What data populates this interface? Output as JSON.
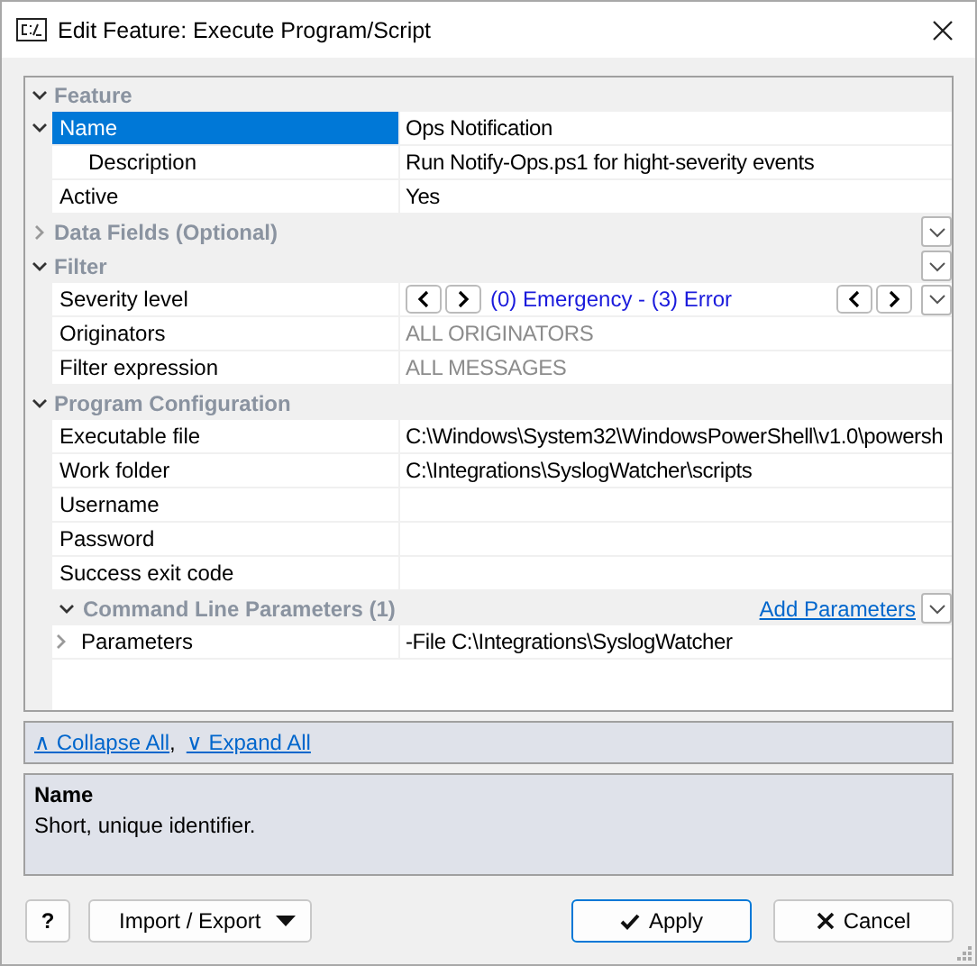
{
  "window": {
    "title": "Edit Feature: Execute Program/Script"
  },
  "grid": {
    "sections": [
      {
        "label": "Feature",
        "expanded": true,
        "menu_button": false,
        "rows": [
          {
            "kind": "text",
            "label": "Name",
            "value": "Ops Notification",
            "selected": true,
            "muted": false,
            "expanded": true,
            "children": [
              {
                "kind": "text",
                "label": "Description",
                "value": "Run Notify-Ops.ps1 for hight-severity events",
                "selected": false,
                "muted": false
              }
            ]
          },
          {
            "kind": "text",
            "label": "Active",
            "value": "Yes",
            "selected": false,
            "muted": false
          }
        ]
      },
      {
        "label": "Data Fields (Optional)",
        "expanded": false,
        "menu_button": true
      },
      {
        "label": "Filter",
        "expanded": true,
        "menu_button": true,
        "rows": [
          {
            "kind": "range",
            "label": "Severity level",
            "value": "(0) Emergency - (3) Error",
            "selected": false,
            "muted": false
          },
          {
            "kind": "text",
            "label": "Originators",
            "value": "ALL ORIGINATORS",
            "selected": false,
            "muted": true
          },
          {
            "kind": "text",
            "label": "Filter expression",
            "value": "ALL MESSAGES",
            "selected": false,
            "muted": true
          }
        ]
      },
      {
        "label": "Program Configuration",
        "expanded": true,
        "menu_button": false,
        "rows": [
          {
            "kind": "text",
            "label": "Executable file",
            "value": "C:\\Windows\\System32\\WindowsPowerShell\\v1.0\\powersh",
            "selected": false,
            "muted": false
          },
          {
            "kind": "text",
            "label": "Work folder",
            "value": "C:\\Integrations\\SyslogWatcher\\scripts",
            "selected": false,
            "muted": false
          },
          {
            "kind": "text",
            "label": "Username",
            "selected": false
          },
          {
            "kind": "text",
            "label": "Password",
            "selected": false
          },
          {
            "kind": "text",
            "label": "Success exit code",
            "selected": false
          },
          {
            "kind": "subcategory",
            "label": "Command Line Parameters (1)",
            "link": "Add Parameters",
            "expanded": true,
            "children": [
              {
                "kind": "text",
                "label": "Parameters",
                "value": "-File C:\\Integrations\\SyslogWatcher",
                "selected": false,
                "muted": false,
                "expanded": false
              }
            ]
          }
        ]
      }
    ]
  },
  "links": {
    "items": [
      "∧ Collapse All",
      "∨ Expand All"
    ],
    "separator": ","
  },
  "help": {
    "title": "Name",
    "text": "Short, unique identifier."
  },
  "buttons": {
    "help": "?",
    "import_export": "Import / Export",
    "apply": "Apply",
    "cancel": "Cancel"
  }
}
